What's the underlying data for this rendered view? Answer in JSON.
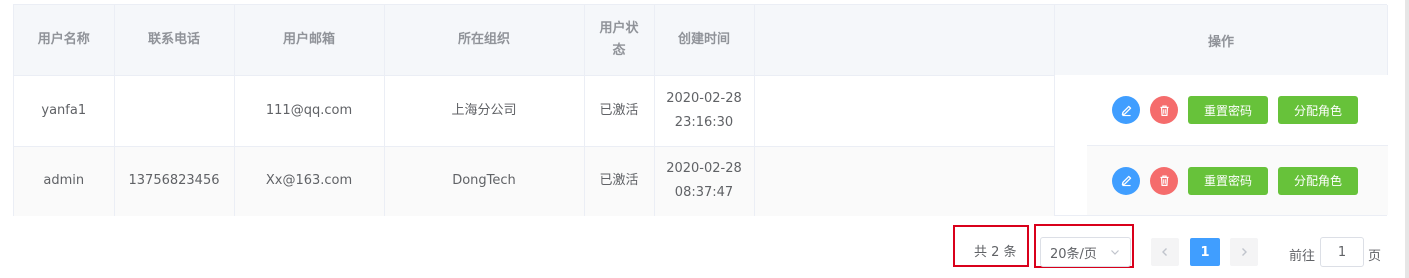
{
  "table": {
    "headers": {
      "username": "用户名称",
      "phone": "联系电话",
      "email": "用户邮箱",
      "org": "所在组织",
      "status_line1": "用户状",
      "status_line2": "态",
      "created": "创建时间",
      "actions": "操作"
    },
    "rows": [
      {
        "username": "yanfa1",
        "phone": "",
        "email": "111@qq.com",
        "org": "上海分公司",
        "status": "已激活",
        "created_date": "2020-02-28",
        "created_time": "23:16:30"
      },
      {
        "username": "admin",
        "phone": "13756823456",
        "email": "Xx@163.com",
        "org": "DongTech",
        "status": "已激活",
        "created_date": "2020-02-28",
        "created_time": "08:37:47"
      }
    ],
    "row_actions": {
      "edit_icon": "pencil-icon",
      "delete_icon": "trash-icon",
      "reset_password": "重置密码",
      "assign_role": "分配角色"
    }
  },
  "pagination": {
    "total": "共 2 条",
    "page_size": "20条/页",
    "current_page": "1",
    "goto_prefix": "前往",
    "goto_value": "1",
    "goto_suffix": "页"
  },
  "colors": {
    "primary": "#409eff",
    "danger": "#f56c6c",
    "success": "#67c23a",
    "highlight": "#d9001b"
  }
}
